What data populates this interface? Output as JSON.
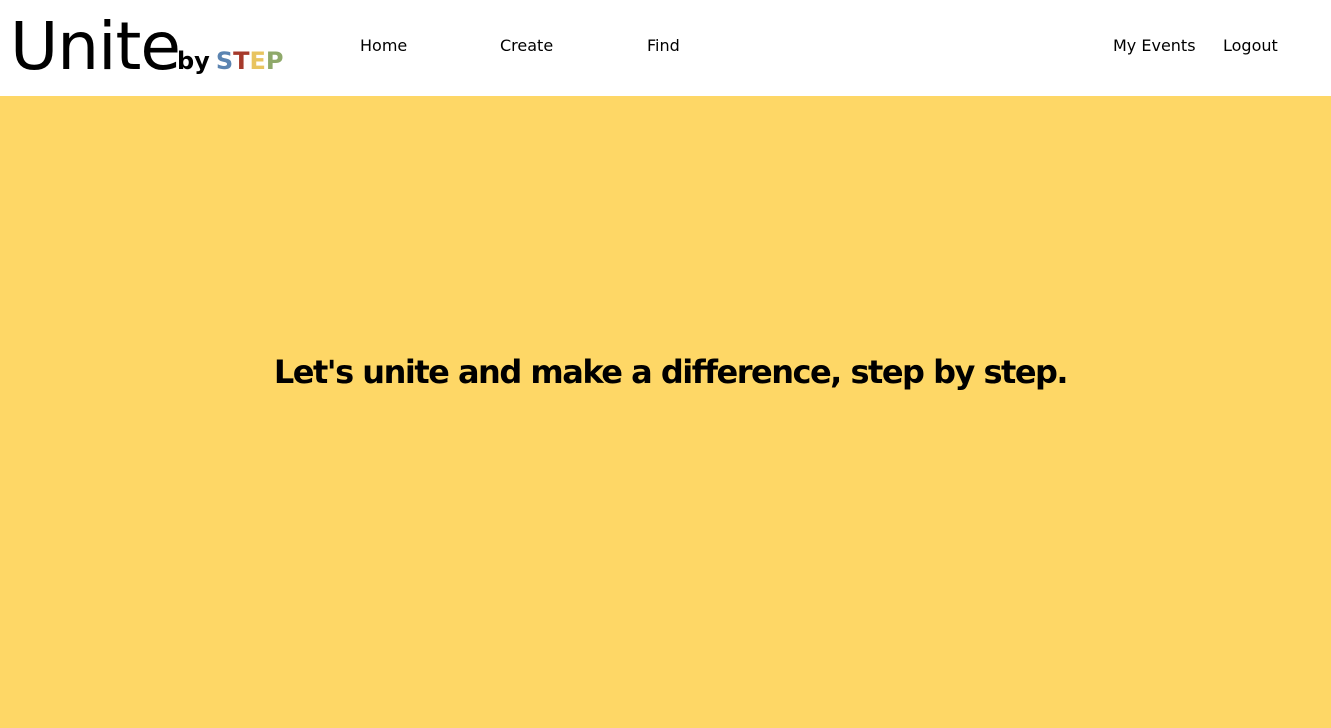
{
  "brand": {
    "name": "Unite",
    "by": "by",
    "step_letters": [
      {
        "char": "S",
        "color": "#5b84b1"
      },
      {
        "char": "T",
        "color": "#a63a2b"
      },
      {
        "char": "E",
        "color": "#e8c460"
      },
      {
        "char": "P",
        "color": "#8fa96a"
      }
    ]
  },
  "nav": {
    "left": [
      {
        "label": "Home"
      },
      {
        "label": "Create"
      },
      {
        "label": "Find"
      }
    ],
    "right": [
      {
        "label": "My Events"
      },
      {
        "label": "Logout"
      }
    ]
  },
  "hero": {
    "heading": "Let's unite and make a difference, step by step.",
    "background": "#fed766"
  }
}
